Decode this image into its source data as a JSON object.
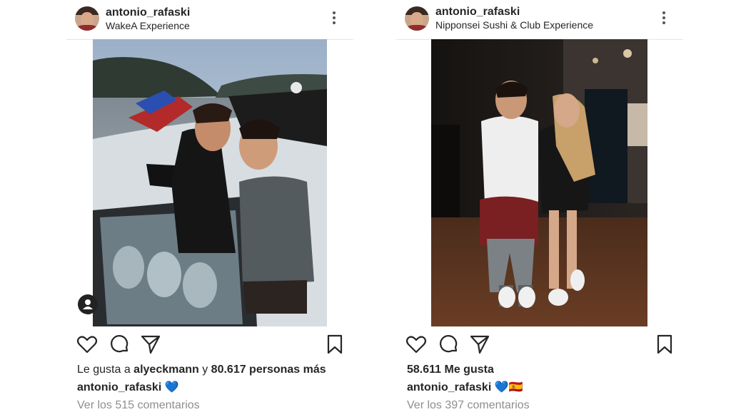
{
  "posts": [
    {
      "username": "antonio_rafaski",
      "location": "WakeA Experience",
      "likes_prefix": "Le gusta a ",
      "likes_user": "alyeckmann",
      "likes_middle": " y ",
      "likes_count": "80.617 personas más",
      "caption_user": "antonio_rafaski",
      "caption_text": " 💙",
      "comments": "Ver los 515 comentarios"
    },
    {
      "username": "antonio_rafaski",
      "location": "Nipponsei Sushi & Club Experience",
      "likes_count": "58.611 Me gusta",
      "caption_user": "antonio_rafaski",
      "caption_text": " 💙🇪🇸",
      "comments": "Ver los 397 comentarios"
    }
  ],
  "icons": {
    "like": "heart-icon",
    "comment": "comment-icon",
    "share": "send-icon",
    "save": "bookmark-icon",
    "more": "more-options-icon",
    "tag": "user-tag-icon"
  },
  "colors": {
    "text": "#262626",
    "muted": "#8e8e8e",
    "divider": "#e6e6e6"
  }
}
